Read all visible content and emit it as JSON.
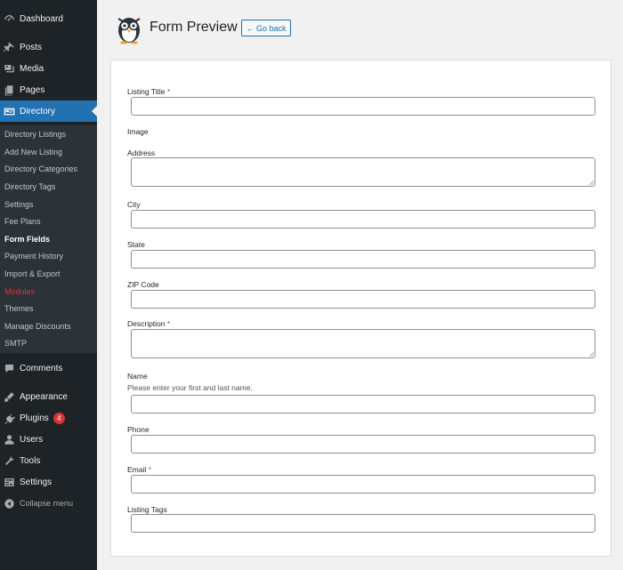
{
  "sidebar": {
    "top_items": [
      {
        "label": "Dashboard",
        "icon": "dashboard-icon"
      },
      {
        "label": "Posts",
        "icon": "pin-icon"
      },
      {
        "label": "Media",
        "icon": "media-icon"
      },
      {
        "label": "Pages",
        "icon": "pages-icon"
      },
      {
        "label": "Directory",
        "icon": "directory-icon"
      }
    ],
    "submenu": [
      "Directory Listings",
      "Add New Listing",
      "Directory Categories",
      "Directory Tags",
      "Settings",
      "Fee Plans",
      "Form Fields",
      "Payment History",
      "Import & Export",
      "Modules",
      "Themes",
      "Manage Discounts",
      "SMTP"
    ],
    "bottom_items": [
      {
        "label": "Comments",
        "icon": "comments-icon"
      },
      {
        "label": "Appearance",
        "icon": "appearance-icon"
      },
      {
        "label": "Plugins",
        "icon": "plugins-icon",
        "badge": "4"
      },
      {
        "label": "Users",
        "icon": "users-icon"
      },
      {
        "label": "Tools",
        "icon": "tools-icon"
      },
      {
        "label": "Settings",
        "icon": "settings-icon"
      }
    ],
    "collapse_label": "Collapse menu"
  },
  "header": {
    "title": "Form Preview",
    "go_back_label": "← Go back"
  },
  "form": {
    "fields": [
      {
        "label": "Listing Title",
        "required": "*"
      },
      {
        "label": "Image"
      },
      {
        "label": "Address"
      },
      {
        "label": "City"
      },
      {
        "label": "State"
      },
      {
        "label": "ZIP Code"
      },
      {
        "label": "Description",
        "required": "*"
      },
      {
        "label": "Name",
        "description": "Please enter your first and last name."
      },
      {
        "label": "Phone"
      },
      {
        "label": "Email",
        "required": "*"
      },
      {
        "label": "Listing Tags"
      }
    ]
  },
  "colors": {
    "sidebar_bg": "#1d2327",
    "submenu_bg": "#2c3338",
    "accent": "#2271b1",
    "required": "#d63638"
  }
}
